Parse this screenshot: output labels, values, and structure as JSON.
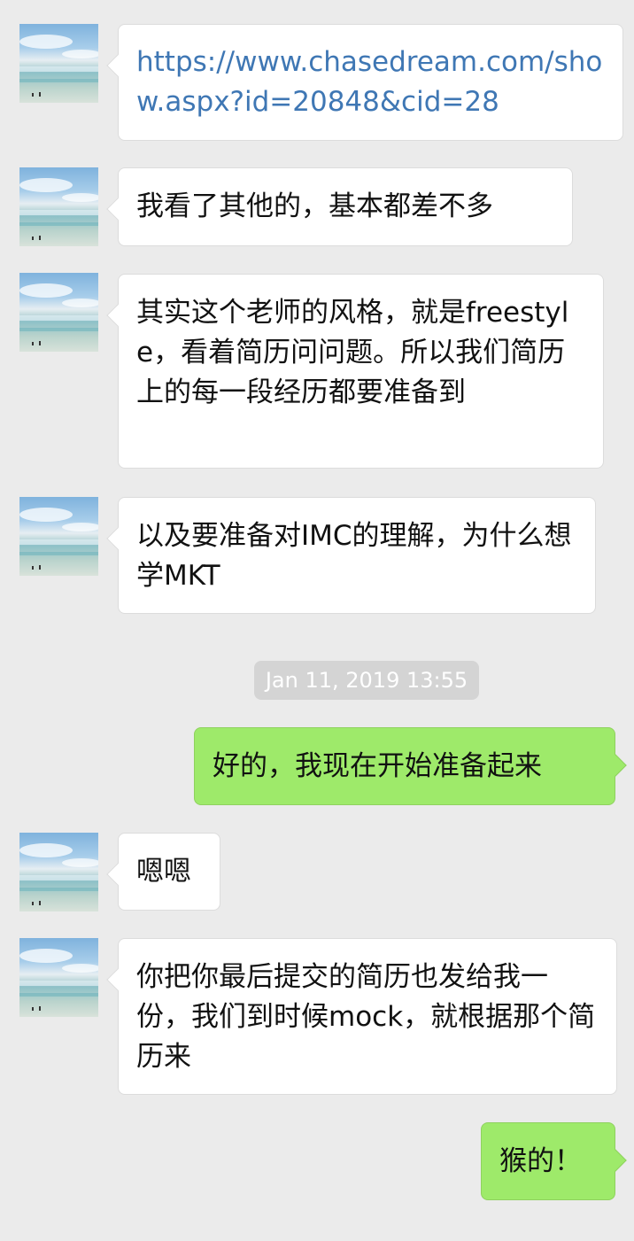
{
  "chat": {
    "messages": [
      {
        "sender": "contact",
        "text": "https://www.chasedream.com/show.aspx?id=20848&cid=28",
        "is_link": true
      },
      {
        "sender": "contact",
        "text": "我看了其他的，基本都差不多"
      },
      {
        "sender": "contact",
        "text": "其实这个老师的风格，就是freestyle，看着简历问问题。所以我们简历上的每一段经历都要准备到"
      },
      {
        "sender": "contact",
        "text": "以及要准备对IMC的理解，为什么想学MKT"
      },
      {
        "sender": "me",
        "text": "好的，我现在开始准备起来"
      },
      {
        "sender": "contact",
        "text": "嗯嗯"
      },
      {
        "sender": "contact",
        "text": "你把你最后提交的简历也发给我一份，我们到时候mock，就根据那个简历来"
      },
      {
        "sender": "me",
        "text": "猴的！"
      }
    ],
    "timestamp": "Jan 11, 2019 13:55"
  },
  "colors": {
    "background": "#ebebeb",
    "incoming_bubble": "#ffffff",
    "outgoing_bubble": "#9eea6a",
    "link": "#3f77b4",
    "timestamp_bg": "#d4d4d4"
  },
  "icons": {
    "avatar": "beach-sky-photo"
  }
}
